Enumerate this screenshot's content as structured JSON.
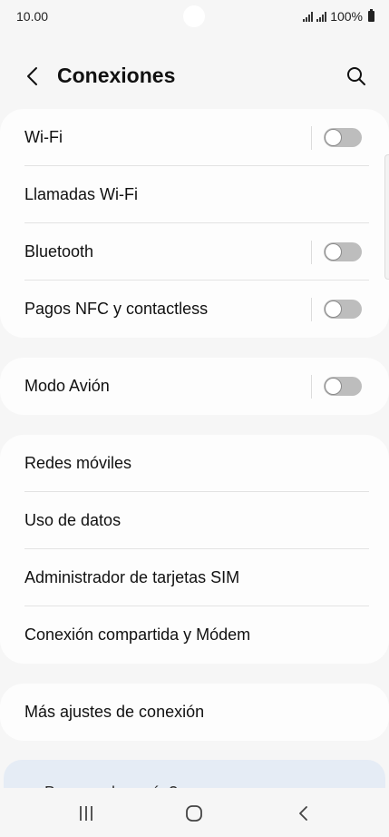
{
  "status_bar": {
    "time": "10.00",
    "battery_text": "100%"
  },
  "header": {
    "title": "Conexiones",
    "back_icon": "chevron-left-icon",
    "search_icon": "search-icon"
  },
  "groups": [
    {
      "items": [
        {
          "label": "Wi-Fi",
          "has_toggle": true,
          "toggle_on": false
        },
        {
          "label": "Llamadas Wi-Fi",
          "has_toggle": false
        },
        {
          "label": "Bluetooth",
          "has_toggle": true,
          "toggle_on": false
        },
        {
          "label": "Pagos NFC y contactless",
          "has_toggle": true,
          "toggle_on": false
        }
      ]
    },
    {
      "items": [
        {
          "label": "Modo Avión",
          "has_toggle": true,
          "toggle_on": false
        }
      ]
    },
    {
      "items": [
        {
          "label": "Redes móviles",
          "has_toggle": false
        },
        {
          "label": "Uso de datos",
          "has_toggle": false
        },
        {
          "label": "Administrador de tarjetas SIM",
          "has_toggle": false
        },
        {
          "label": "Conexión compartida y Módem",
          "has_toggle": false
        }
      ]
    },
    {
      "items": [
        {
          "label": "Más ajustes de conexión",
          "has_toggle": false
        }
      ]
    }
  ],
  "partial_card": {
    "text": "¿Buscas algo más?"
  },
  "colors": {
    "background": "#f6f6f6",
    "card": "#fdfdfd",
    "toggle_off": "#bdbdbd",
    "suggestion_card": "#e5ecf5"
  },
  "nav": {
    "recents_icon": "recents-icon",
    "home_icon": "home-icon",
    "back_icon": "back-icon"
  }
}
